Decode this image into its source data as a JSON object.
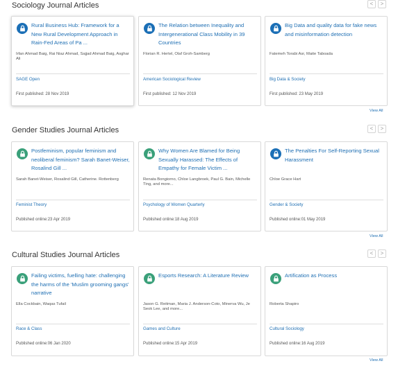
{
  "sections": [
    {
      "title": "Sociology Journal Articles",
      "view_all": "View All",
      "cards": [
        {
          "title": "Rural Business Hub: Framework for a New Rural Development Approach in Rain-Fed Areas of Pa ...",
          "authors": "Irfan Ahmad Baig, Rai Niaz Ahmad, Sajjad Ahmad Baig, Asghar Ali",
          "journal": "SAGE Open",
          "date": "First published: 28 Nov 2019",
          "lock_color": "#1b6fb6"
        },
        {
          "title": "The Relation between Inequality and Intergenerational Class Mobility in 39 Countries",
          "authors": "Florian R. Hertel, Olaf Groh-Samberg",
          "journal": "American Sociological Review",
          "date": "First published: 12 Nov 2019",
          "lock_color": "#1b6fb6"
        },
        {
          "title": "Big Data and quality data for fake news and misinformation detection",
          "authors": "Fatemeh Torabi Asr, Maite Taboada",
          "journal": "Big Data & Society",
          "date": "First published: 23 May 2019",
          "lock_color": "#1b6fb6"
        }
      ]
    },
    {
      "title": "Gender Studies Journal Articles",
      "view_all": "View All",
      "cards": [
        {
          "title": "Postfeminism, popular feminism and neoliberal feminism? Sarah Banet-Weiser, Rosalind Gill ...",
          "authors": "Sarah Banet-Weiser, Rosalind Gill, Catherine. Rottenberg",
          "journal": "Feminist Theory",
          "date": "Published online:23 Apr 2019",
          "lock_color": "#3aa07a"
        },
        {
          "title": "Why Women Are Blamed for Being Sexually Harassed: The Effects of Empathy for Female Victim ...",
          "authors": "Renata Bongiorno, Chloe Langbroek, Paul G. Bain, Michelle Ting, and more...",
          "journal": "Psychology of Women Quarterly",
          "date": "Published online:18 Aug 2019",
          "lock_color": "#3aa07a"
        },
        {
          "title": "The Penalties For Self-Reporting Sexual Harassment",
          "authors": "Chloe Grace Hart",
          "journal": "Gender & Society",
          "date": "Published online:01 May 2019",
          "lock_color": "#1b6fb6"
        }
      ]
    },
    {
      "title": "Cultural Studies Journal Articles",
      "view_all": "View All",
      "cards": [
        {
          "title": "Failing victims, fuelling hate: challenging the harms of the 'Muslim grooming gangs' narrative",
          "authors": "Ella Cockbain, Waqas Tufail",
          "journal": "Race & Class",
          "date": "Published online:06 Jan 2020",
          "lock_color": "#3aa07a"
        },
        {
          "title": "Esports Research: A Literature Review",
          "authors": "Jason G. Reitman, Maria J. Anderson-Coto, Minerva Wu, Je Seok Lee, and more...",
          "journal": "Games and Culture",
          "date": "Published online:15 Apr 2019",
          "lock_color": "#3aa07a"
        },
        {
          "title": "Artification as Process",
          "authors": "Roberta Shapiro",
          "journal": "Cultural Sociology",
          "date": "Published online:16 Aug 2019",
          "lock_color": "#3aa07a"
        }
      ]
    }
  ],
  "nav": {
    "prev": "<",
    "next": ">"
  }
}
